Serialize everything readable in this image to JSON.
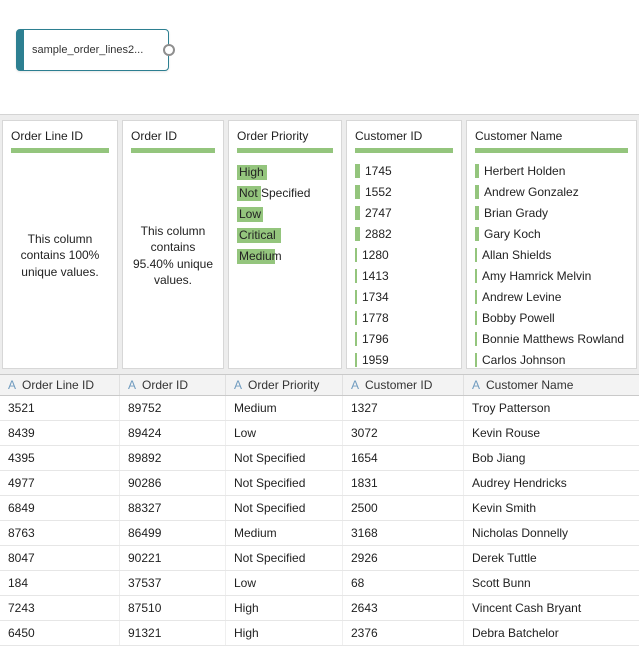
{
  "flow": {
    "node_label": "sample_order_lines2..."
  },
  "colors": {
    "accent_teal": "#2d7f91",
    "bar_green": "#94c57d"
  },
  "profile": {
    "cards": [
      {
        "title": "Order Line ID",
        "kind": "summary",
        "summary": "This column contains 100% unique values."
      },
      {
        "title": "Order ID",
        "kind": "summary",
        "summary": "This column contains 95.40% unique values."
      },
      {
        "title": "Order Priority",
        "kind": "histogram",
        "items": [
          {
            "label": "High",
            "bar": 30
          },
          {
            "label": "Not Specified",
            "bar": 24
          },
          {
            "label": "Low",
            "bar": 26
          },
          {
            "label": "Critical",
            "bar": 44
          },
          {
            "label": "Medium",
            "bar": 38
          }
        ]
      },
      {
        "title": "Customer ID",
        "kind": "list",
        "items": [
          {
            "label": "1745",
            "tick": 5
          },
          {
            "label": "1552",
            "tick": 5
          },
          {
            "label": "2747",
            "tick": 5
          },
          {
            "label": "2882",
            "tick": 5
          },
          {
            "label": "1280",
            "tick": 2
          },
          {
            "label": "1413",
            "tick": 2
          },
          {
            "label": "1734",
            "tick": 2
          },
          {
            "label": "1778",
            "tick": 2
          },
          {
            "label": "1796",
            "tick": 2
          },
          {
            "label": "1959",
            "tick": 2
          }
        ]
      },
      {
        "title": "Customer Name",
        "kind": "list",
        "items": [
          {
            "label": "Herbert Holden",
            "tick": 4
          },
          {
            "label": "Andrew Gonzalez",
            "tick": 4
          },
          {
            "label": "Brian Grady",
            "tick": 4
          },
          {
            "label": "Gary Koch",
            "tick": 4
          },
          {
            "label": "Allan Shields",
            "tick": 2
          },
          {
            "label": "Amy Hamrick Melvin",
            "tick": 2
          },
          {
            "label": "Andrew Levine",
            "tick": 2
          },
          {
            "label": "Bobby Powell",
            "tick": 2
          },
          {
            "label": "Bonnie Matthews Rowland",
            "tick": 2
          },
          {
            "label": "Carlos Johnson",
            "tick": 2
          }
        ]
      }
    ]
  },
  "grid": {
    "columns": [
      {
        "name": "Order Line ID",
        "type": "A"
      },
      {
        "name": "Order ID",
        "type": "A"
      },
      {
        "name": "Order Priority",
        "type": "A"
      },
      {
        "name": "Customer ID",
        "type": "A"
      },
      {
        "name": "Customer Name",
        "type": "A"
      }
    ],
    "rows": [
      [
        "3521",
        "89752",
        "Medium",
        "1327",
        "Troy Patterson"
      ],
      [
        "8439",
        "89424",
        "Low",
        "3072",
        "Kevin Rouse"
      ],
      [
        "4395",
        "89892",
        "Not Specified",
        "1654",
        "Bob Jiang"
      ],
      [
        "4977",
        "90286",
        "Not Specified",
        "1831",
        "Audrey Hendricks"
      ],
      [
        "6849",
        "88327",
        "Not Specified",
        "2500",
        "Kevin Smith"
      ],
      [
        "8763",
        "86499",
        "Medium",
        "3168",
        "Nicholas Donnelly"
      ],
      [
        "8047",
        "90221",
        "Not Specified",
        "2926",
        "Derek Tuttle"
      ],
      [
        "184",
        "37537",
        "Low",
        "68",
        "Scott Bunn"
      ],
      [
        "7243",
        "87510",
        "High",
        "2643",
        "Vincent Cash Bryant"
      ],
      [
        "6450",
        "91321",
        "High",
        "2376",
        "Debra Batchelor"
      ]
    ]
  }
}
